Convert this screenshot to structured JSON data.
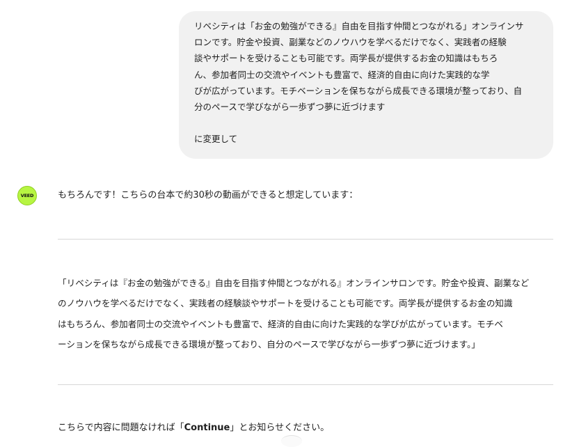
{
  "user_message": {
    "text": "リベシティは「お金の勉強ができる』自由を目指す仲間とつながれる」オンラインサ\nロンです。貯金や投資、副業などのノウハウを学べるだけでなく、実践者の経験\n談やサポートを受けることも可能です。両学長が提供するお金の知識はもちろ\nん、参加者同士の交流やイベントも豊富で、経済的自由に向けた実践的な学\nびが広がっています。モチベーションを保ちながら成長できる環境が整っており、自\n分のペースで学びながら一歩ずつ夢に近づけます\n\nに変更して"
  },
  "assistant": {
    "avatar_label": "VEED",
    "intro": "もちろんです！こちらの台本で約30秒の動画ができると想定しています：",
    "script_quote": "「リベシティは『お金の勉強ができる』自由を目指す仲間とつながれる』オンラインサロンです。貯金や投資、副業など\nのノウハウを学べるだけでなく、実践者の経験談やサポートを受けることも可能です。両学長が提供するお金の知識\nはもちろん、参加者同士の交流やイベントも豊富で、経済的自由に向けた実践的な学びが広がっています。モチベ\nーションを保ちながら成長できる環境が整っており、自分のペースで学びながら一歩ずつ夢に近づけます。」",
    "outro_prefix": "こちらで内容に問題なければ「",
    "outro_keyword": "Continue",
    "outro_suffix": "」とお知らせください。"
  },
  "colors": {
    "user_bubble_bg": "#f1f1f1",
    "avatar_bg": "#b7f542",
    "divider": "#d6d6d6",
    "text": "#1f1f1f"
  }
}
